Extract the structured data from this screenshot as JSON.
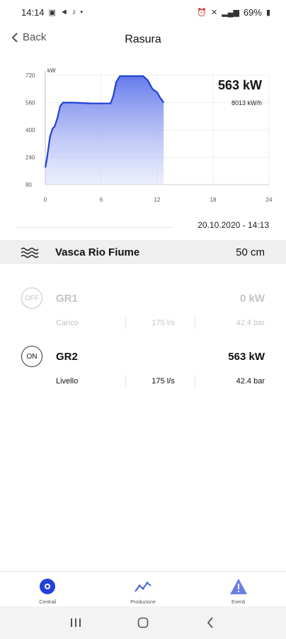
{
  "status_bar": {
    "time": "14:14",
    "battery": "69%"
  },
  "header": {
    "back_label": "Back",
    "title": "Rasura"
  },
  "chart_data": {
    "type": "area",
    "y_unit": "kW",
    "x_ticks": [
      "0",
      "6",
      "12",
      "18",
      "24"
    ],
    "y_ticks": [
      "80",
      "240",
      "400",
      "560",
      "720"
    ],
    "xlim": [
      0,
      24
    ],
    "ylim": [
      80,
      720
    ],
    "grid": true,
    "x": [
      0,
      0.2,
      0.5,
      0.8,
      1.0,
      1.3,
      1.6,
      1.9,
      3,
      5,
      7,
      7.3,
      7.6,
      8,
      9,
      10,
      10.5,
      11,
      11.5,
      12,
      12.3,
      12.7
    ],
    "y": [
      180,
      240,
      360,
      410,
      420,
      470,
      540,
      560,
      560,
      555,
      555,
      600,
      680,
      715,
      715,
      715,
      715,
      690,
      640,
      620,
      590,
      560
    ],
    "color": "#2141d8"
  },
  "power_now": "563 kW",
  "energy_rate": "8013 kW/h",
  "timestamp": "20.10.2020 - 14:13",
  "basin": {
    "name": "Vasca Rio Fiume",
    "level": "50 cm"
  },
  "units": [
    {
      "status": "OFF",
      "name": "GR1",
      "power": "0 kW",
      "label": "Carico",
      "flow": "175 l/s",
      "pressure": "42.4 bar"
    },
    {
      "status": "ON",
      "name": "GR2",
      "power": "563 kW",
      "label": "Livello",
      "flow": "175 l/s",
      "pressure": "42.4 bar"
    }
  ],
  "bottom_nav": {
    "items": [
      {
        "label": "Centrali",
        "icon": "power-plant-icon"
      },
      {
        "label": "Produzione",
        "icon": "trend-icon"
      },
      {
        "label": "Eventi",
        "icon": "warning-icon"
      }
    ],
    "accent": "#2141d8"
  }
}
